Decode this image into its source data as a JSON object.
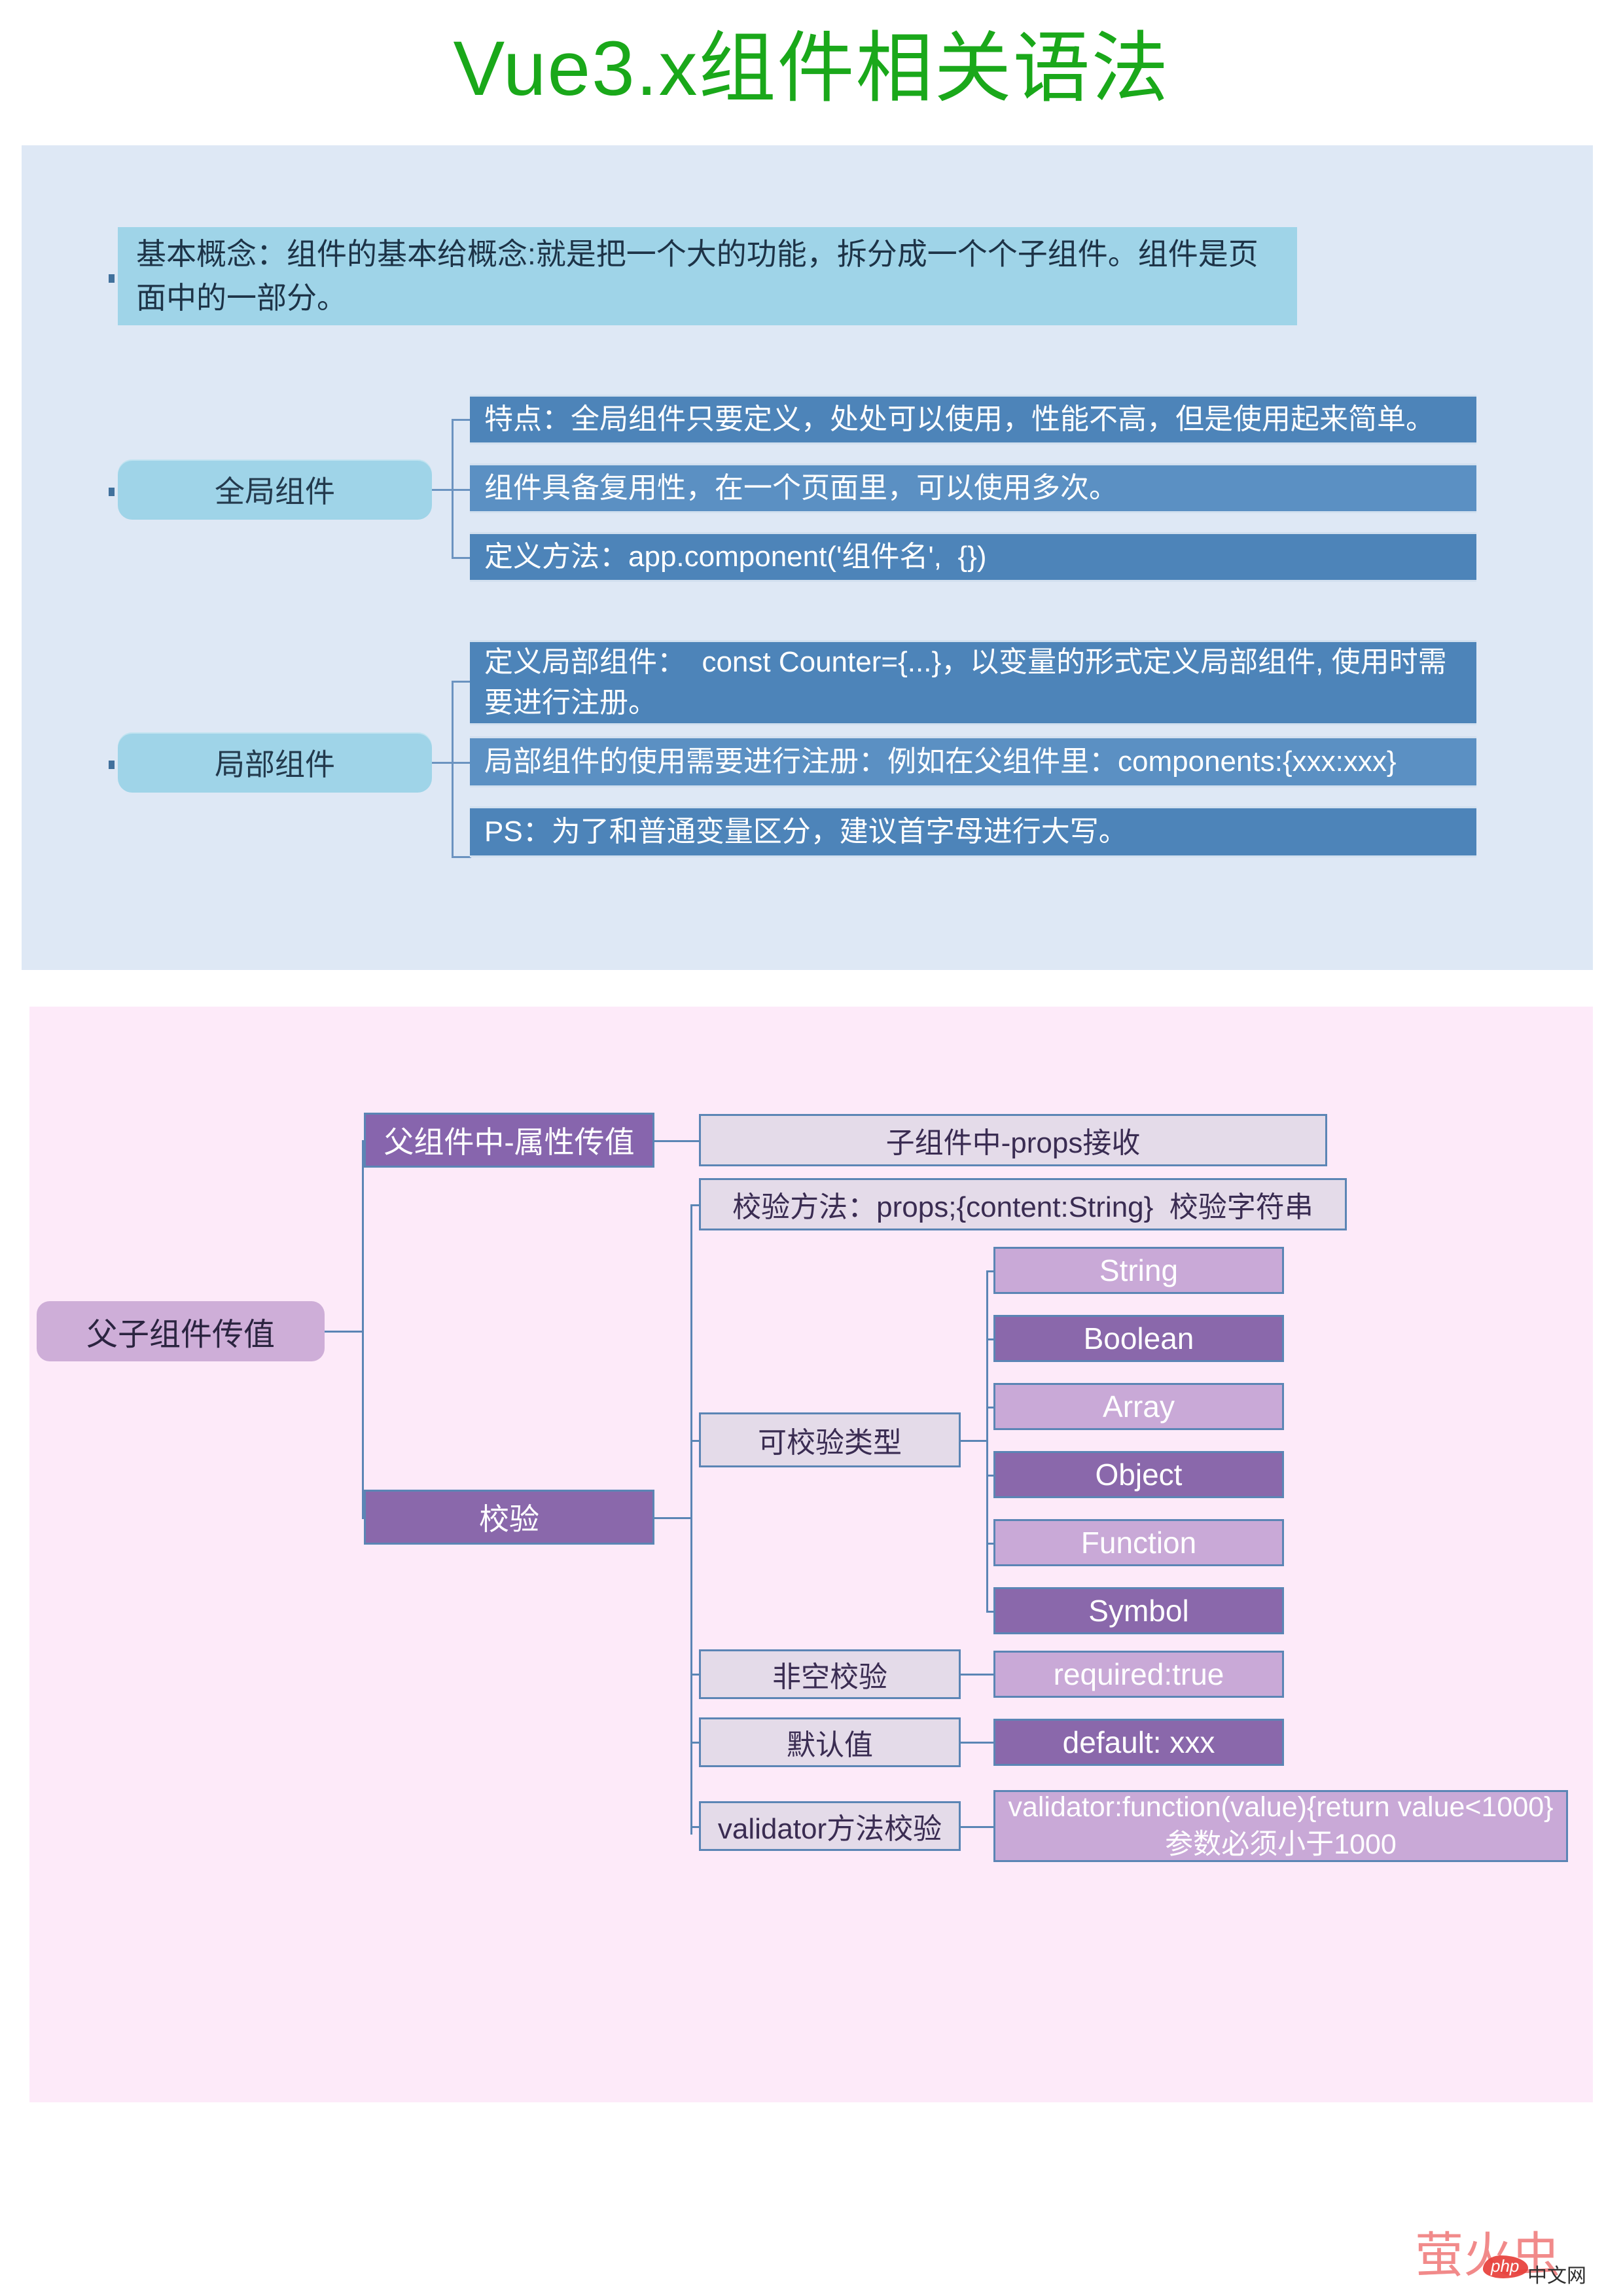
{
  "title": "Vue3.x组件相关语法",
  "colors": {
    "title_green": "#1aa81a",
    "panel_blue_bg": "#dee8f5",
    "panel_pink_bg": "#fdeaf9",
    "blue_parent": "#9fd4e8",
    "blue_child": "#4d84b9",
    "connector": "#5b85b5",
    "purple_dark": "#8765ad",
    "purple_mid": "#c9a9d7",
    "purple_pale": "#e4dbe9",
    "purple_root": "#ceaed8",
    "watermark_red": "#f07a7a"
  },
  "section_component": {
    "intro": "基本概念：组件的基本给概念:就是把一个大的功能，拆分成一个个子组件。组件是页面中的一部分。",
    "branches": [
      {
        "label": "全局组件",
        "children": [
          "特点：全局组件只要定义，处处可以使用，性能不高，但是使用起来简单。",
          "组件具备复用性，在一个页面里，可以使用多次。",
          "定义方法：app.component('组件名',  {})"
        ]
      },
      {
        "label": "局部组件",
        "children": [
          "定义局部组件：  const Counter={...}，以变量的形式定义局部组件, 使用时需要进行注册。",
          "局部组件的使用需要进行注册：例如在父组件里：components:{xxx:xxx}",
          "PS：为了和普通变量区分，建议首字母进行大写。"
        ]
      }
    ]
  },
  "section_props": {
    "root": "父子组件传值",
    "branch_pass": {
      "label": "父组件中-属性传值",
      "child": "子组件中-props接收"
    },
    "branch_validate": {
      "label": "校验",
      "method": "校验方法：props;{content:String}  校验字符串",
      "types_label": "可校验类型",
      "types": [
        "String",
        "Boolean",
        "Array",
        "Object",
        "Function",
        "Symbol"
      ],
      "required_label": "非空校验",
      "required_value": "required:true",
      "default_label": "默认值",
      "default_value": "default: xxx",
      "validator_label": "validator方法校验",
      "validator_value": "validator:function(value){return value<1000}\n参数必须小于1000"
    }
  },
  "watermark": {
    "main": "萤火虫",
    "badge": "php",
    "suffix": "中文网"
  }
}
